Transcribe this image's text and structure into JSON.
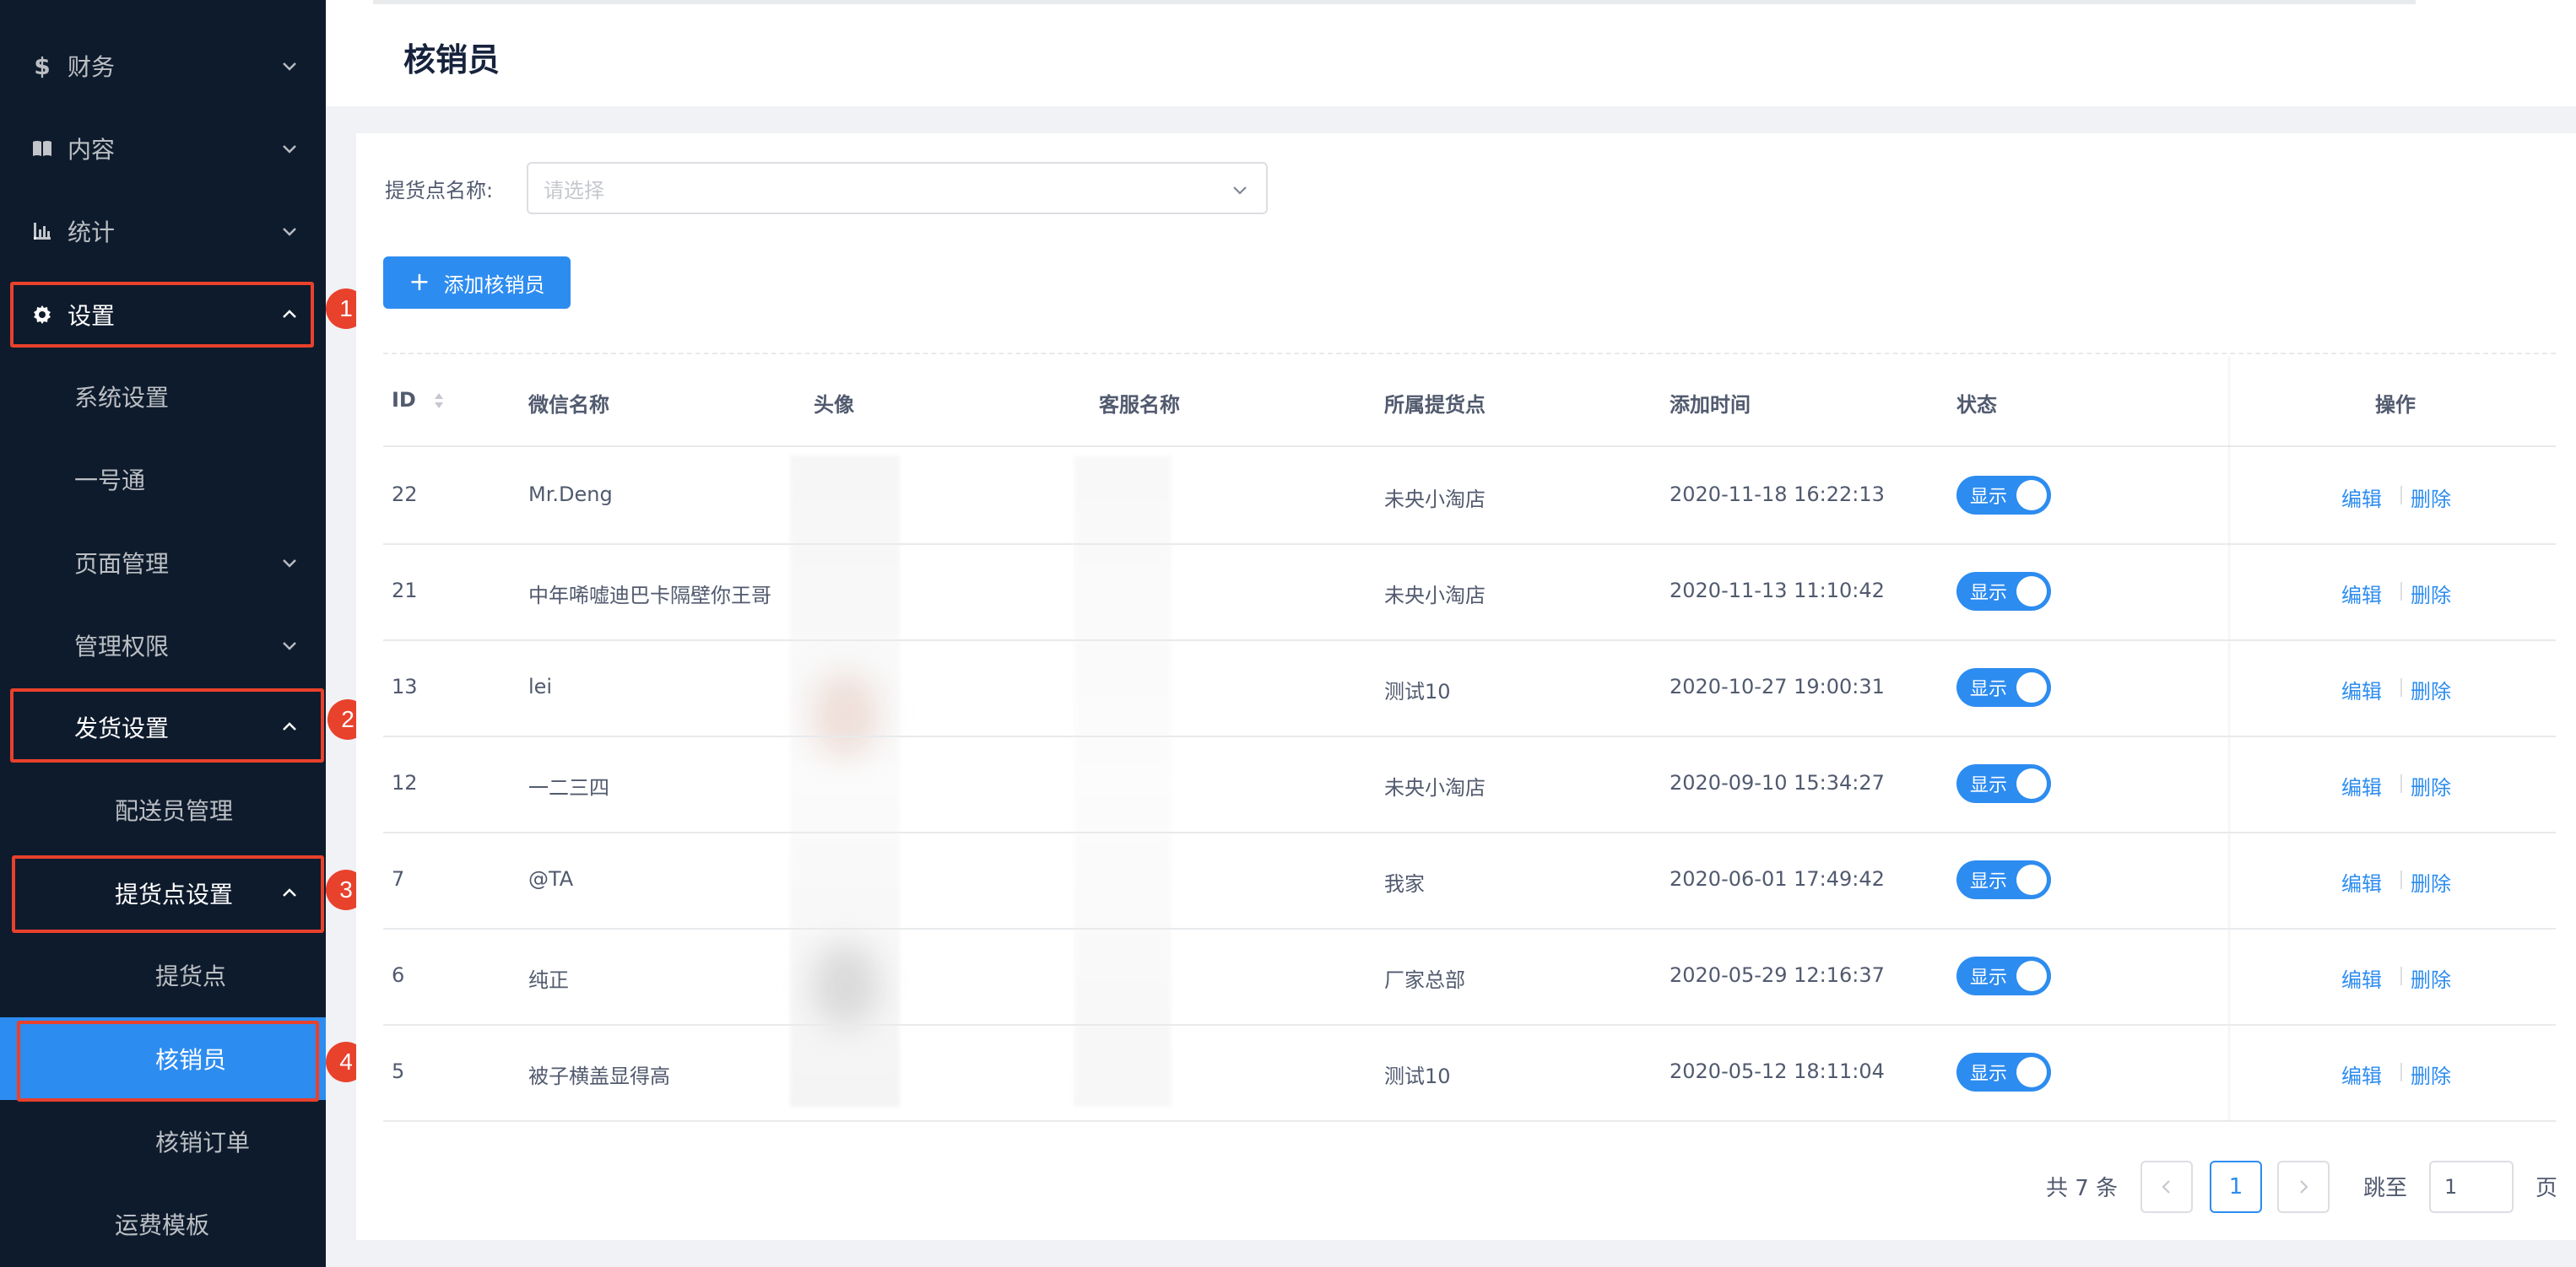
{
  "sidebar": {
    "items": [
      {
        "label": "财务",
        "icon": "dollar-icon"
      },
      {
        "label": "内容",
        "icon": "book-icon"
      },
      {
        "label": "统计",
        "icon": "bar-chart-icon"
      },
      {
        "label": "设置",
        "icon": "gear-icon"
      },
      {
        "label": "系统设置"
      },
      {
        "label": "一号通"
      },
      {
        "label": "页面管理"
      },
      {
        "label": "管理权限"
      },
      {
        "label": "发货设置"
      },
      {
        "label": "配送员管理"
      },
      {
        "label": "提货点设置"
      },
      {
        "label": "提货点"
      },
      {
        "label": "核销员"
      },
      {
        "label": "核销订单"
      },
      {
        "label": "运费模板"
      }
    ],
    "annotations": [
      "1",
      "2",
      "3",
      "4"
    ]
  },
  "header": {
    "title": "核销员"
  },
  "filter": {
    "label": "提货点名称:",
    "placeholder": "请选择"
  },
  "toolbar": {
    "add_label": "添加核销员"
  },
  "table": {
    "columns": [
      "ID",
      "微信名称",
      "头像",
      "客服名称",
      "所属提货点",
      "添加时间",
      "状态",
      "操作"
    ],
    "rows": [
      {
        "id": "22",
        "wechat": "Mr.Deng",
        "store": "未央小淘店",
        "time": "2020-11-18 16:22:13",
        "status": "显示"
      },
      {
        "id": "21",
        "wechat": "中年唏嘘迪巴卡隔壁你王哥",
        "store": "未央小淘店",
        "time": "2020-11-13 11:10:42",
        "status": "显示"
      },
      {
        "id": "13",
        "wechat": "lei",
        "store": "测试10",
        "time": "2020-10-27 19:00:31",
        "status": "显示"
      },
      {
        "id": "12",
        "wechat": "一二三四",
        "store": "未央小淘店",
        "time": "2020-09-10 15:34:27",
        "status": "显示"
      },
      {
        "id": "7",
        "wechat": "@TA",
        "store": "我家",
        "time": "2020-06-01 17:49:42",
        "status": "显示"
      },
      {
        "id": "6",
        "wechat": "纯正",
        "store": "厂家总部",
        "time": "2020-05-29 12:16:37",
        "status": "显示"
      },
      {
        "id": "5",
        "wechat": "被子横盖显得高",
        "store": "测试10",
        "time": "2020-05-12 18:11:04",
        "status": "显示"
      }
    ],
    "edit_label": "编辑",
    "delete_label": "删除"
  },
  "pagination": {
    "total_text": "共 7 条",
    "current": "1",
    "jump_label": "跳至",
    "jump_value": "1",
    "page_suffix": "页"
  },
  "colors": {
    "accent": "#2d8cf0",
    "sidebar_bg": "#0e1b2c",
    "annotation": "#e8412c"
  }
}
